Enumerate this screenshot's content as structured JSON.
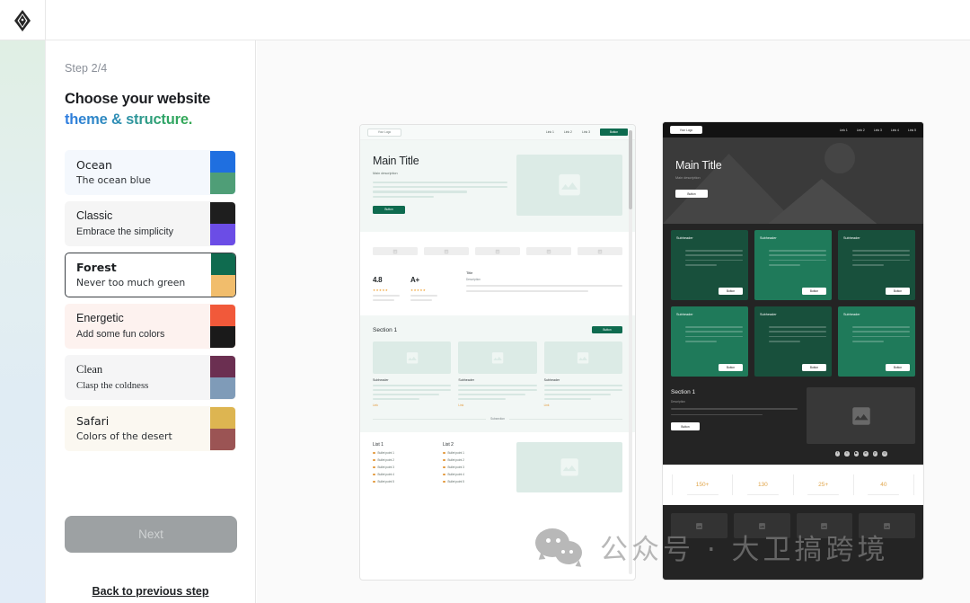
{
  "topbar": {
    "logo_icon": "diamond-logo-icon"
  },
  "panel": {
    "step_label": "Step 2/4",
    "headline_line1": "Choose your website",
    "headline_line2": "theme & structure.",
    "next_label": "Next",
    "back_label": "Back to previous step",
    "themes": [
      {
        "name": "Ocean",
        "desc": "The ocean blue",
        "bg": "#f4f8fd",
        "swatch_top": "#1f6fe0",
        "swatch_bottom": "#4f9e77",
        "selected": false
      },
      {
        "name": "Classic",
        "desc": "Embrace the simplicity",
        "bg": "#f5f5f5",
        "swatch_top": "#1e1e1e",
        "swatch_bottom": "#6b4de6",
        "selected": false
      },
      {
        "name": "Forest",
        "desc": "Never too much green",
        "bg": "#ffffff",
        "swatch_top": "#0f6b4f",
        "swatch_bottom": "#f1bd6c",
        "selected": true
      },
      {
        "name": "Energetic",
        "desc": "Add some fun colors",
        "bg": "#fdf2ef",
        "swatch_top": "#f1593a",
        "swatch_bottom": "#1a1a1a",
        "selected": false
      },
      {
        "name": "Clean",
        "desc": "Clasp the coldness",
        "bg": "#f5f5f6",
        "swatch_top": "#6b2f51",
        "swatch_bottom": "#7f9bb8",
        "selected": false
      },
      {
        "name": "Safari",
        "desc": "Colors of the desert",
        "bg": "#fbf8f1",
        "swatch_top": "#ddb551",
        "swatch_bottom": "#9b5454",
        "selected": false
      }
    ]
  },
  "preview_light": {
    "logo": "Your Logo",
    "nav_links": [
      "Link 1",
      "Link 2",
      "Link 3"
    ],
    "nav_button": "Button",
    "hero_title": "Main Title",
    "hero_desc": "Main description",
    "hero_button": "Button",
    "stats": [
      {
        "value": "4.8",
        "stars": "★★★★★"
      },
      {
        "value": "A+",
        "stars": "★★★★★"
      }
    ],
    "stat_wide_title": "Title",
    "stat_wide_desc": "Description",
    "section_title": "Section 1",
    "section_button": "Button",
    "cards": [
      {
        "subheader": "Subheader",
        "link": "Link"
      },
      {
        "subheader": "Subheader",
        "link": "Link"
      },
      {
        "subheader": "Subheader",
        "link": "Link"
      }
    ],
    "subsection_label": "Subsection",
    "lists": [
      {
        "title": "List 1",
        "items": [
          "Bullet point 1",
          "Bullet point 2",
          "Bullet point 3",
          "Bullet point 4",
          "Bullet point 5"
        ]
      },
      {
        "title": "List 2",
        "items": [
          "Bullet point 1",
          "Bullet point 2",
          "Bullet point 3",
          "Bullet point 4",
          "Bullet point 5"
        ]
      }
    ],
    "accent_color": "#0e6b4f",
    "link_color": "#e2983a"
  },
  "preview_dark": {
    "logo": "Your Logo",
    "nav_links": [
      "Link 1",
      "Link 2",
      "Link 3",
      "Link 4",
      "Link 5"
    ],
    "hero_title": "Main Title",
    "hero_desc": "Main description",
    "hero_button": "Button",
    "cards": [
      {
        "subheader": "Subheader",
        "button": "Button",
        "bg": "#18503c"
      },
      {
        "subheader": "Subheader",
        "button": "Button",
        "bg": "#1f7a5a"
      },
      {
        "subheader": "Subheader",
        "button": "Button",
        "bg": "#18503c"
      },
      {
        "subheader": "Subheader",
        "button": "Button",
        "bg": "#1f7a5a"
      },
      {
        "subheader": "Subheader",
        "button": "Button",
        "bg": "#18503c"
      },
      {
        "subheader": "Subheader",
        "button": "Button",
        "bg": "#1f7a5a"
      }
    ],
    "section_title": "Section 1",
    "section_desc": "Description",
    "section_button": "Button",
    "social_icons": [
      "facebook-icon",
      "twitter-icon",
      "youtube-icon",
      "linkedin-icon",
      "pinterest-icon",
      "instagram-icon"
    ],
    "stats": [
      {
        "value": "150+"
      },
      {
        "value": "130"
      },
      {
        "value": "25+"
      },
      {
        "value": "40"
      }
    ],
    "stat_color": "#e0a54a",
    "card_accent": "#1f7a5a"
  },
  "watermark": {
    "text": "公众号 · 大卫搞跨境",
    "icon": "wechat-icon"
  }
}
